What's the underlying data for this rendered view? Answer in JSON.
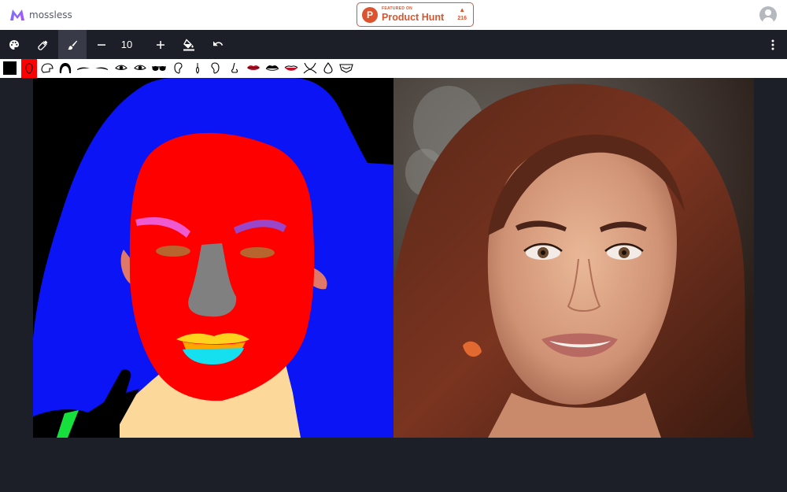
{
  "app": {
    "name": "mossless"
  },
  "product_hunt": {
    "featured_label": "FEATURED ON",
    "name": "Product Hunt",
    "votes": "216",
    "letter": "P"
  },
  "toolbar": {
    "brush_size": "10",
    "icons": [
      "palette-icon",
      "eyedropper-icon",
      "brush-icon",
      "minus-icon",
      "plus-icon",
      "fill-bucket-icon",
      "undo-icon",
      "more-vert-icon"
    ]
  },
  "parts": {
    "colors": {
      "background": "#000000",
      "skin": "#ff0000"
    },
    "icons": [
      "face-outline-icon",
      "neck-icon",
      "hair-icon",
      "left-brow-icon",
      "right-brow-icon",
      "left-eye-icon",
      "right-eye-icon",
      "glasses-icon",
      "left-ear-icon",
      "earring-icon",
      "right-ear-icon",
      "nose-icon",
      "mouth-icon",
      "upper-lip-icon",
      "lower-lip-icon",
      "neckline-icon",
      "necklace-icon",
      "cloth-icon"
    ]
  },
  "colors": {
    "accent": "#da552f",
    "toolbar_bg": "#1c1e28",
    "active_tool": "#383b47",
    "hair_mask": "#0a14f5",
    "skin_mask": "#ff0000"
  }
}
